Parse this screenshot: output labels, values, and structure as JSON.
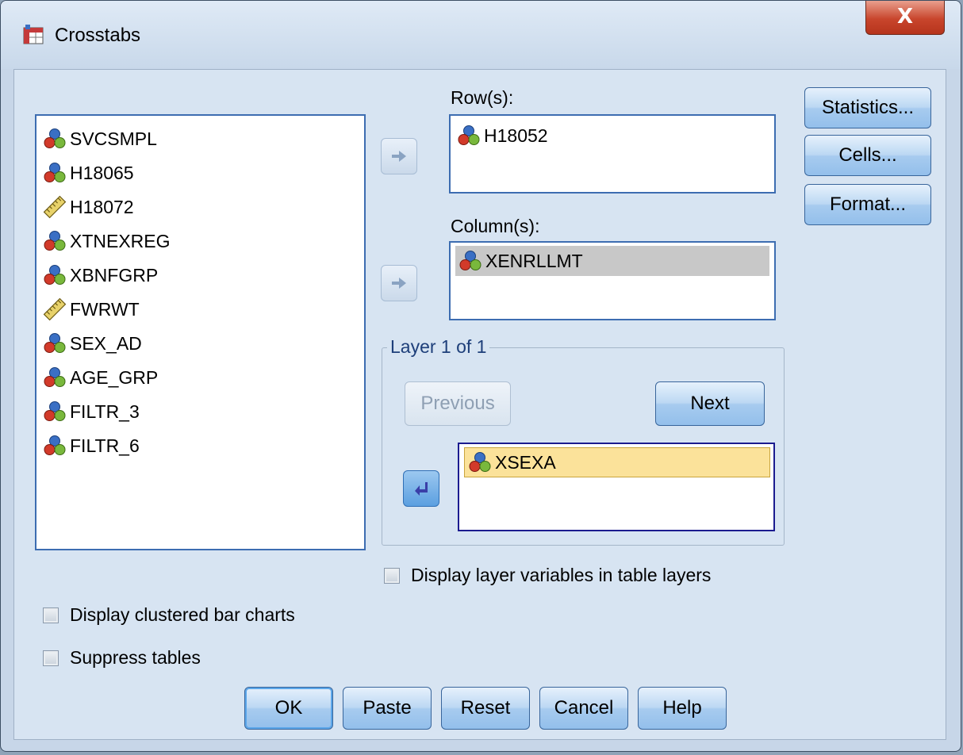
{
  "window": {
    "title": "Crosstabs",
    "close_glyph": "X"
  },
  "source_variables": [
    {
      "name": "SVCSMPL",
      "icon": "nominal-icon"
    },
    {
      "name": "H18065",
      "icon": "nominal-icon"
    },
    {
      "name": "H18072",
      "icon": "scale-ruler-icon"
    },
    {
      "name": "XTNEXREG",
      "icon": "nominal-icon"
    },
    {
      "name": "XBNFGRP",
      "icon": "nominal-icon"
    },
    {
      "name": "FWRWT",
      "icon": "scale-ruler-icon"
    },
    {
      "name": "SEX_AD",
      "icon": "nominal-icon"
    },
    {
      "name": "AGE_GRP",
      "icon": "nominal-icon"
    },
    {
      "name": "FILTR_3",
      "icon": "nominal-icon"
    },
    {
      "name": "FILTR_6",
      "icon": "nominal-icon"
    }
  ],
  "rows": {
    "label": "Row(s):",
    "items": [
      "H18052"
    ]
  },
  "columns": {
    "label": "Column(s):",
    "items": [
      "XENRLLMT"
    ]
  },
  "layer": {
    "legend": "Layer 1 of 1",
    "previous_label": "Previous",
    "next_label": "Next",
    "items": [
      "XSEXA"
    ]
  },
  "side_buttons": {
    "statistics": "Statistics...",
    "cells": "Cells...",
    "format": "Format..."
  },
  "options": {
    "display_layer_vars": {
      "label": "Display layer variables in table layers",
      "checked": false
    },
    "clustered_bar": {
      "label": "Display clustered bar charts",
      "checked": false
    },
    "suppress_tables": {
      "label": "Suppress tables",
      "checked": false
    }
  },
  "buttons": {
    "ok": "OK",
    "paste": "Paste",
    "reset": "Reset",
    "cancel": "Cancel",
    "help": "Help"
  }
}
